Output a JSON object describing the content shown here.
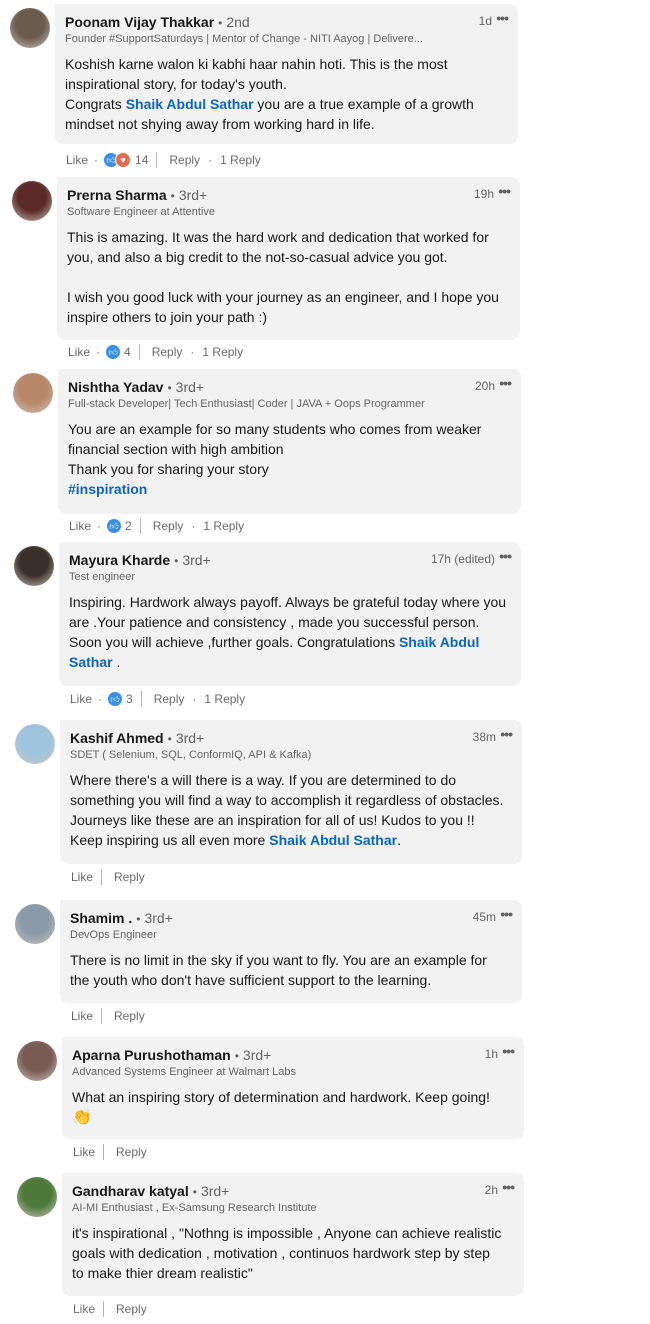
{
  "comments": [
    {
      "name": "Poonam Vijay Thakkar",
      "degree": "2nd",
      "headline": "Founder #SupportSaturdays | Mentor of Change - NITI Aayog | Delivere...",
      "time": "1d",
      "body_parts": [
        "Koshish karne walon ki kabhi haar nahin hoti. This is the most\ninspirational story, for today's youth.\nCongrats ",
        "Shaik Abdul Sathar",
        " you are a true example of a growth\nmindset not shying away from working hard in life."
      ],
      "mention_index": 1,
      "avatar_color": "#6b5a4e",
      "actions": {
        "like": "Like",
        "reply": "Reply",
        "replies": "1 Reply",
        "reaction_count": "14",
        "reactions": [
          "like",
          "love"
        ]
      }
    },
    {
      "name": "Prerna Sharma",
      "degree": "3rd+",
      "headline": "Software Engineer at Attentive",
      "time": "19h",
      "body_parts": [
        "This is amazing. It was the hard work and dedication that worked for\nyou, and also a big credit to the not-so-casual advice you got.\n\nI wish you good luck with your journey as an engineer, and I hope you\ninspire others to join your path :)"
      ],
      "mention_index": -1,
      "avatar_color": "#5a2a28",
      "actions": {
        "like": "Like",
        "reply": "Reply",
        "replies": "1 Reply",
        "reaction_count": "4",
        "reactions": [
          "like"
        ]
      }
    },
    {
      "name": "Nishtha Yadav",
      "degree": "3rd+",
      "headline": "Full-stack Developer| Tech Enthusiast| Coder | JAVA + Oops Programmer",
      "time": "20h",
      "body_parts": [
        "You are an example for so many students who comes from weaker\nfinancial section with high ambition\nThank you for sharing your story\n",
        "#inspiration"
      ],
      "mention_index": 1,
      "avatar_color": "#b8876a",
      "actions": {
        "like": "Like",
        "reply": "Reply",
        "replies": "1 Reply",
        "reaction_count": "2",
        "reactions": [
          "like"
        ]
      }
    },
    {
      "name": "Mayura Kharde",
      "degree": "3rd+",
      "headline": "Test engineer",
      "time": "17h (edited)",
      "body_parts": [
        "Inspiring. Hardwork always payoff. Always be grateful today where you\nare .Your patience and consistency , made you successful person.\nSoon you will achieve ,further goals. Congratulations ",
        "Shaik Abdul\nSathar",
        " ."
      ],
      "mention_index": 1,
      "avatar_color": "#3a3028",
      "actions": {
        "like": "Like",
        "reply": "Reply",
        "replies": "1 Reply",
        "reaction_count": "3",
        "reactions": [
          "like"
        ]
      }
    },
    {
      "name": "Kashif Ahmed",
      "degree": "3rd+",
      "headline": "SDET ( Selenium, SQL, ConformIQ, API & Kafka)",
      "time": "38m",
      "body_parts": [
        "Where there's a will there is a way. If you are determined to do\nsomething you will find a way to accomplish it regardless of obstacles.\nJourneys like these are an inspiration for all of us! Kudos to you !!\nKeep inspiring us all even more ",
        "Shaik Abdul Sathar",
        "."
      ],
      "mention_index": 1,
      "avatar_color": "#9ec4e0",
      "actions": {
        "like": "Like",
        "reply": "Reply"
      }
    },
    {
      "name": "Shamim .",
      "degree": "3rd+",
      "headline": "DevOps Engineer",
      "time": "45m",
      "body_parts": [
        "There is no limit in the sky if you want to fly. You are an example for\nthe youth who don't have sufficient support to the learning."
      ],
      "mention_index": -1,
      "avatar_color": "#8a9aa8",
      "actions": {
        "like": "Like",
        "reply": "Reply"
      }
    },
    {
      "name": "Aparna Purushothaman",
      "degree": "3rd+",
      "headline": "Advanced Systems Engineer at Walmart Labs",
      "time": "1h",
      "body_parts": [
        "What an inspiring story of determination and hardwork. Keep going!\n",
        "👏"
      ],
      "mention_index": -1,
      "avatar_color": "#7a5a55",
      "actions": {
        "like": "Like",
        "reply": "Reply"
      }
    },
    {
      "name": "Gandharav katyal",
      "degree": "3rd+",
      "headline": "AI-MI Enthusiast , Ex-Samsung Research Institute",
      "time": "2h",
      "body_parts": [
        "it's inspirational , \"Nothng is impossible , Anyone can achieve realistic\ngoals with dedication , motivation , continuos hardwork step by step\nto make thier dream realistic\""
      ],
      "mention_index": -1,
      "avatar_color": "#4d7a3a",
      "actions": {
        "like": "Like",
        "reply": "Reply"
      }
    }
  ],
  "colors": {
    "link": "#0a66c2",
    "bubble": "#f2f2f2",
    "like_icon": "#378fe9",
    "love_icon": "#df704d"
  }
}
